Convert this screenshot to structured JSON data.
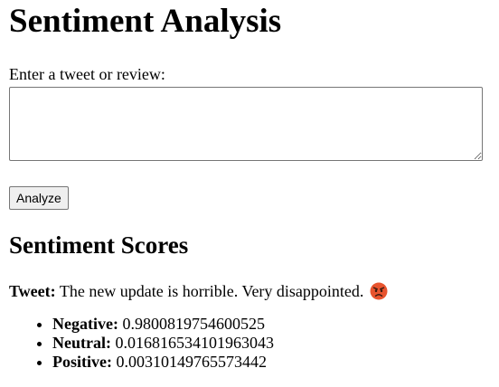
{
  "page": {
    "title": "Sentiment Analysis"
  },
  "form": {
    "input_label": "Enter a tweet or review:",
    "input_value": "",
    "analyze_label": "Analyze"
  },
  "results": {
    "section_title": "Sentiment Scores",
    "tweet_label": "Tweet:",
    "tweet_text": "The new update is horrible. Very disappointed.",
    "tweet_emoji_icon": "angry-face-icon",
    "scores": [
      {
        "label": "Negative:",
        "value": "0.9800819754600525"
      },
      {
        "label": "Neutral:",
        "value": "0.016816534101963043"
      },
      {
        "label": "Positive:",
        "value": "0.00310149765573442"
      }
    ]
  },
  "colors": {
    "emoji_face": "#e8542f",
    "button_bg": "#efefef",
    "border": "#767676"
  }
}
